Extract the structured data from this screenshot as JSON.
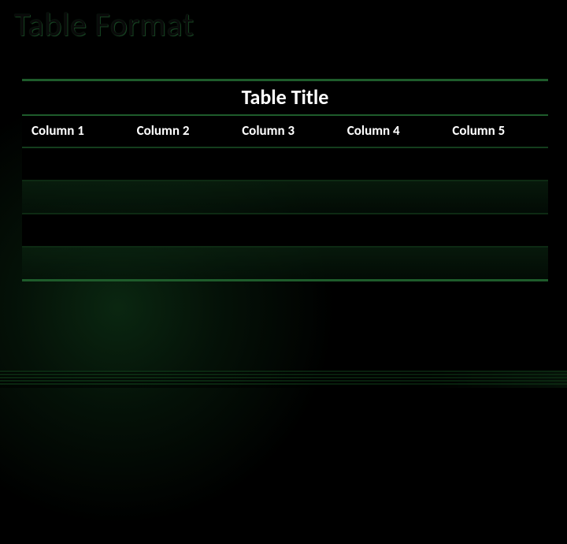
{
  "slide": {
    "title": "Table Format"
  },
  "table": {
    "title": "Table Title",
    "columns": [
      "Column 1",
      "Column 2",
      "Column 3",
      "Column 4",
      "Column 5"
    ],
    "rows": [
      [
        "",
        "",
        "",
        "",
        ""
      ],
      [
        "",
        "",
        "",
        "",
        ""
      ],
      [
        "",
        "",
        "",
        "",
        ""
      ],
      [
        "",
        "",
        "",
        "",
        ""
      ]
    ]
  },
  "colors": {
    "accent_green": "#1e5c2b",
    "dark_green": "#0d2a13",
    "background": "#000000",
    "text": "#ffffff"
  }
}
